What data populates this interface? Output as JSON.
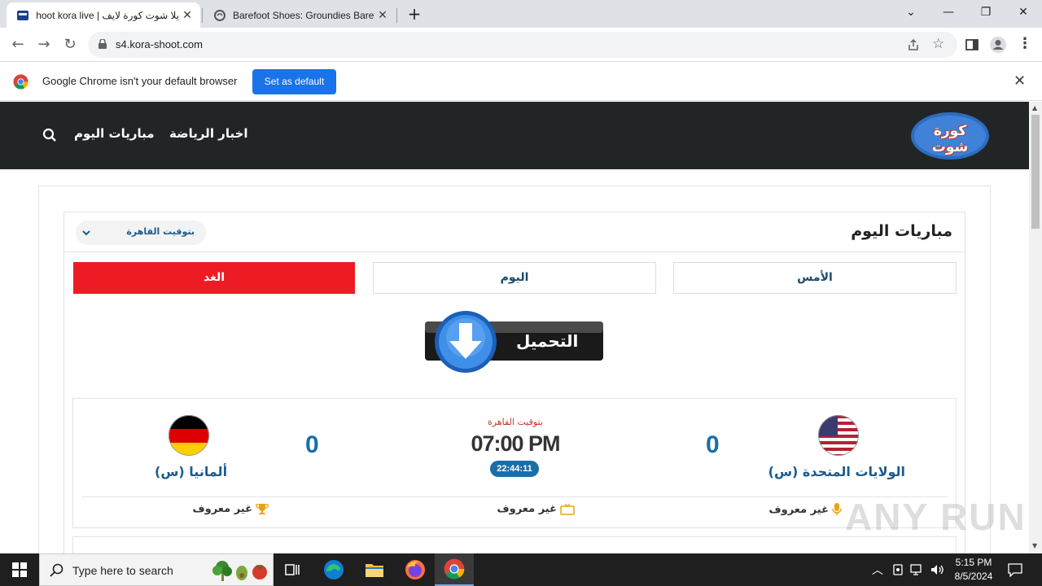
{
  "browser": {
    "tabs": [
      {
        "title": "يلا شوت كورة لايف | Yalla shoot kora live",
        "active": true
      },
      {
        "title": "Barefoot Shoes: Groundies Barefoot Shoes",
        "active": false
      }
    ],
    "new_tab": "+",
    "window_controls": {
      "dropdown": "⌄",
      "minimize": "—",
      "restore": "❐",
      "close": "✕"
    },
    "url": "s4.kora-shoot.com",
    "infobar": {
      "message": "Google Chrome isn't your default browser",
      "button": "Set as default"
    }
  },
  "site": {
    "logo_text": "كورة شوت",
    "nav": {
      "today_matches": "مباريات اليوم",
      "sports_news": "اخبار الرياضة"
    },
    "panel_title": "مباريات اليوم",
    "timezone": "بتوقيت القاهرة",
    "day_tabs": {
      "yesterday": "الأمس",
      "today": "اليوم",
      "tomorrow": "الغد"
    },
    "ad_label": "التحميل",
    "match": {
      "home": {
        "name": "الولايات المتحدة (س)",
        "score": "0"
      },
      "away": {
        "name": "ألمانيا (س)",
        "score": "0"
      },
      "timezone_label": "بتوقيت القاهرة",
      "time": "07:00 PM",
      "countdown": "22:44:11",
      "commentator": "غير معروف",
      "channel": "غير معروف",
      "league": "غير معروف"
    }
  },
  "taskbar": {
    "search_placeholder": "Type here to search",
    "time": "5:15 PM",
    "date": "8/5/2024"
  },
  "watermark": "ANY RUN",
  "colors": {
    "header_bg": "#222526",
    "accent_red": "#ed1c24",
    "accent_blue": "#1b6ea5",
    "chrome_blue": "#1a73e8"
  }
}
